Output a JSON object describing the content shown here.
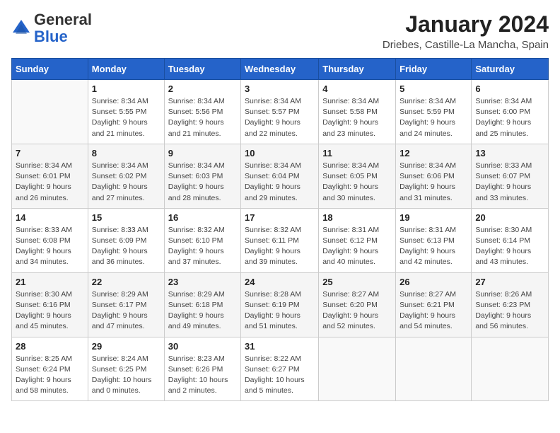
{
  "header": {
    "logo_general": "General",
    "logo_blue": "Blue",
    "month": "January 2024",
    "location": "Driebes, Castille-La Mancha, Spain"
  },
  "weekdays": [
    "Sunday",
    "Monday",
    "Tuesday",
    "Wednesday",
    "Thursday",
    "Friday",
    "Saturday"
  ],
  "weeks": [
    [
      {
        "day": "",
        "info": ""
      },
      {
        "day": "1",
        "info": "Sunrise: 8:34 AM\nSunset: 5:55 PM\nDaylight: 9 hours\nand 21 minutes."
      },
      {
        "day": "2",
        "info": "Sunrise: 8:34 AM\nSunset: 5:56 PM\nDaylight: 9 hours\nand 21 minutes."
      },
      {
        "day": "3",
        "info": "Sunrise: 8:34 AM\nSunset: 5:57 PM\nDaylight: 9 hours\nand 22 minutes."
      },
      {
        "day": "4",
        "info": "Sunrise: 8:34 AM\nSunset: 5:58 PM\nDaylight: 9 hours\nand 23 minutes."
      },
      {
        "day": "5",
        "info": "Sunrise: 8:34 AM\nSunset: 5:59 PM\nDaylight: 9 hours\nand 24 minutes."
      },
      {
        "day": "6",
        "info": "Sunrise: 8:34 AM\nSunset: 6:00 PM\nDaylight: 9 hours\nand 25 minutes."
      }
    ],
    [
      {
        "day": "7",
        "info": "Sunrise: 8:34 AM\nSunset: 6:01 PM\nDaylight: 9 hours\nand 26 minutes."
      },
      {
        "day": "8",
        "info": "Sunrise: 8:34 AM\nSunset: 6:02 PM\nDaylight: 9 hours\nand 27 minutes."
      },
      {
        "day": "9",
        "info": "Sunrise: 8:34 AM\nSunset: 6:03 PM\nDaylight: 9 hours\nand 28 minutes."
      },
      {
        "day": "10",
        "info": "Sunrise: 8:34 AM\nSunset: 6:04 PM\nDaylight: 9 hours\nand 29 minutes."
      },
      {
        "day": "11",
        "info": "Sunrise: 8:34 AM\nSunset: 6:05 PM\nDaylight: 9 hours\nand 30 minutes."
      },
      {
        "day": "12",
        "info": "Sunrise: 8:34 AM\nSunset: 6:06 PM\nDaylight: 9 hours\nand 31 minutes."
      },
      {
        "day": "13",
        "info": "Sunrise: 8:33 AM\nSunset: 6:07 PM\nDaylight: 9 hours\nand 33 minutes."
      }
    ],
    [
      {
        "day": "14",
        "info": "Sunrise: 8:33 AM\nSunset: 6:08 PM\nDaylight: 9 hours\nand 34 minutes."
      },
      {
        "day": "15",
        "info": "Sunrise: 8:33 AM\nSunset: 6:09 PM\nDaylight: 9 hours\nand 36 minutes."
      },
      {
        "day": "16",
        "info": "Sunrise: 8:32 AM\nSunset: 6:10 PM\nDaylight: 9 hours\nand 37 minutes."
      },
      {
        "day": "17",
        "info": "Sunrise: 8:32 AM\nSunset: 6:11 PM\nDaylight: 9 hours\nand 39 minutes."
      },
      {
        "day": "18",
        "info": "Sunrise: 8:31 AM\nSunset: 6:12 PM\nDaylight: 9 hours\nand 40 minutes."
      },
      {
        "day": "19",
        "info": "Sunrise: 8:31 AM\nSunset: 6:13 PM\nDaylight: 9 hours\nand 42 minutes."
      },
      {
        "day": "20",
        "info": "Sunrise: 8:30 AM\nSunset: 6:14 PM\nDaylight: 9 hours\nand 43 minutes."
      }
    ],
    [
      {
        "day": "21",
        "info": "Sunrise: 8:30 AM\nSunset: 6:16 PM\nDaylight: 9 hours\nand 45 minutes."
      },
      {
        "day": "22",
        "info": "Sunrise: 8:29 AM\nSunset: 6:17 PM\nDaylight: 9 hours\nand 47 minutes."
      },
      {
        "day": "23",
        "info": "Sunrise: 8:29 AM\nSunset: 6:18 PM\nDaylight: 9 hours\nand 49 minutes."
      },
      {
        "day": "24",
        "info": "Sunrise: 8:28 AM\nSunset: 6:19 PM\nDaylight: 9 hours\nand 51 minutes."
      },
      {
        "day": "25",
        "info": "Sunrise: 8:27 AM\nSunset: 6:20 PM\nDaylight: 9 hours\nand 52 minutes."
      },
      {
        "day": "26",
        "info": "Sunrise: 8:27 AM\nSunset: 6:21 PM\nDaylight: 9 hours\nand 54 minutes."
      },
      {
        "day": "27",
        "info": "Sunrise: 8:26 AM\nSunset: 6:23 PM\nDaylight: 9 hours\nand 56 minutes."
      }
    ],
    [
      {
        "day": "28",
        "info": "Sunrise: 8:25 AM\nSunset: 6:24 PM\nDaylight: 9 hours\nand 58 minutes."
      },
      {
        "day": "29",
        "info": "Sunrise: 8:24 AM\nSunset: 6:25 PM\nDaylight: 10 hours\nand 0 minutes."
      },
      {
        "day": "30",
        "info": "Sunrise: 8:23 AM\nSunset: 6:26 PM\nDaylight: 10 hours\nand 2 minutes."
      },
      {
        "day": "31",
        "info": "Sunrise: 8:22 AM\nSunset: 6:27 PM\nDaylight: 10 hours\nand 5 minutes."
      },
      {
        "day": "",
        "info": ""
      },
      {
        "day": "",
        "info": ""
      },
      {
        "day": "",
        "info": ""
      }
    ]
  ]
}
